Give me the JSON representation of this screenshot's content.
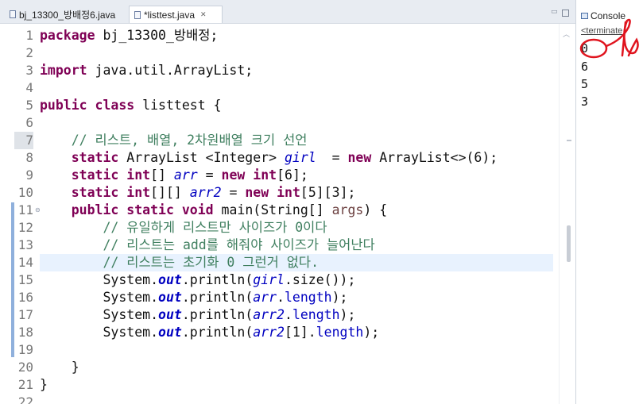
{
  "tabs": [
    {
      "label": "bj_13300_방배정6.java",
      "active": false
    },
    {
      "label": "*listtest.java",
      "active": true,
      "close_glyph": "✕"
    }
  ],
  "editor": {
    "line_numbers": [
      "1",
      "2",
      "3",
      "4",
      "5",
      "6",
      "7",
      "8",
      "9",
      "10",
      "11",
      "12",
      "13",
      "14",
      "15",
      "16",
      "17",
      "18",
      "19",
      "20",
      "21",
      "22"
    ],
    "fold_marker": "⊖",
    "lines": {
      "l1_kw": "package",
      "l1_rest": " bj_13300_방배정;",
      "l3_kw": "import",
      "l3_rest": " java.util.ArrayList;",
      "l5_kw1": "public",
      "l5_kw2": "class",
      "l5_rest": " listtest {",
      "l7_comment": "// 리스트, 배열, 2차원배열 크기 선언",
      "l8_kw": "static",
      "l8_type": " ArrayList <Integer> ",
      "l8_field": "girl",
      "l8_mid": "  = ",
      "l8_new": "new",
      "l8_rest": " ArrayList<>(6);",
      "l9_kw": "static",
      "l9_int": "int",
      "l9_type": "[] ",
      "l9_field": "arr",
      "l9_mid": " = ",
      "l9_new": "new",
      "l9_int2": "int",
      "l9_rest": "[6];",
      "l10_kw": "static",
      "l10_int": "int",
      "l10_type": "[][] ",
      "l10_field": "arr2",
      "l10_mid": " = ",
      "l10_new": "new",
      "l10_int2": "int",
      "l10_rest": "[5][3];",
      "l11_kw1": "public",
      "l11_kw2": "static",
      "l11_kw3": "void",
      "l11_rest1": " main(String[] ",
      "l11_param": "args",
      "l11_rest2": ") {",
      "l12_comment": "// 유일하게 리스트만 사이즈가 0이다",
      "l13_comment": "// 리스트는 add를 해줘야 사이즈가 늘어난다",
      "l14_comment": "// 리스트는 초기화 0 그런거 없다.",
      "l15_a": "System.",
      "l15_out": "out",
      "l15_b": ".println(",
      "l15_f": "girl",
      "l15_c": ".size());",
      "l16_a": "System.",
      "l16_out": "out",
      "l16_b": ".println(",
      "l16_f": "arr",
      "l16_c": ".",
      "l16_len": "length",
      "l16_d": ");",
      "l17_a": "System.",
      "l17_out": "out",
      "l17_b": ".println(",
      "l17_f": "arr2",
      "l17_c": ".",
      "l17_len": "length",
      "l17_d": ");",
      "l18_a": "System.",
      "l18_out": "out",
      "l18_b": ".println(",
      "l18_f": "arr2",
      "l18_c": "[1].",
      "l18_len": "length",
      "l18_d": ");",
      "l20": "}",
      "l21": "}"
    }
  },
  "console": {
    "title": "Console",
    "status": "<terminate",
    "output": [
      "0",
      "6",
      "5",
      "3"
    ]
  },
  "colors": {
    "keyword": "#7f0055",
    "comment": "#3f7f5f",
    "field": "#0000c0",
    "current_line": "#e8f2fe",
    "annotation_red": "#e0141e"
  }
}
